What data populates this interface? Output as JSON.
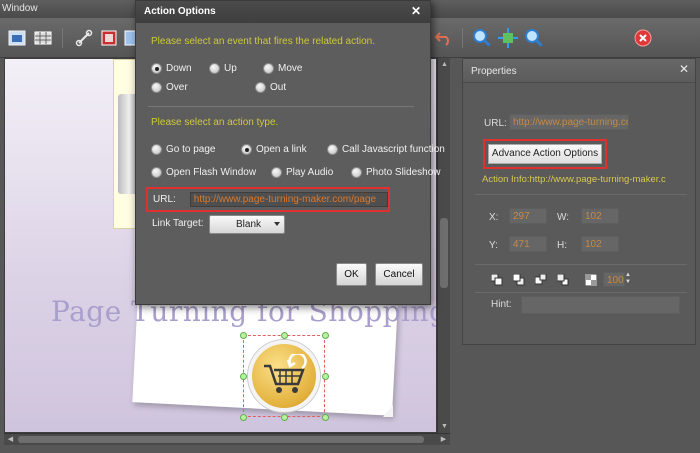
{
  "window": {
    "title": "Window"
  },
  "canvas": {
    "heading": "Page Turning for Shopping"
  },
  "properties": {
    "title": "Properties",
    "url_label": "URL:",
    "url_value": "http://www.page-turning.com",
    "advance_button": "Advance Action Options",
    "action_info": "Action Info:http://www.page-turning-maker.c",
    "x_label": "X:",
    "x_value": "297",
    "w_label": "W:",
    "w_value": "102",
    "y_label": "Y:",
    "y_value": "471",
    "h_label": "H:",
    "h_value": "102",
    "opacity_value": "100",
    "hint_label": "Hint:",
    "hint_value": ""
  },
  "dialog": {
    "title": "Action Options",
    "event_prompt": "Please select an event that fires the related action.",
    "events": [
      {
        "label": "Down",
        "selected": true
      },
      {
        "label": "Up",
        "selected": false
      },
      {
        "label": "Move",
        "selected": false
      },
      {
        "label": "Over",
        "selected": false
      },
      {
        "label": "Out",
        "selected": false
      }
    ],
    "action_prompt": "Please select an action type.",
    "actions": [
      {
        "label": "Go to page",
        "selected": false
      },
      {
        "label": "Open a link",
        "selected": true
      },
      {
        "label": "Call Javascript function",
        "selected": false
      },
      {
        "label": "Open Flash Window",
        "selected": false
      },
      {
        "label": "Play Audio",
        "selected": false
      },
      {
        "label": "Photo Slideshow",
        "selected": false
      }
    ],
    "url_label": "URL:",
    "url_value": "http://www.page-turning-maker.com/page",
    "link_target_label": "Link Target:",
    "link_target_value": "Blank",
    "ok_label": "OK",
    "cancel_label": "Cancel"
  },
  "colors": {
    "highlight_border": "#e03030",
    "prompt_text": "#cfc93b",
    "url_text": "#d87a30"
  }
}
